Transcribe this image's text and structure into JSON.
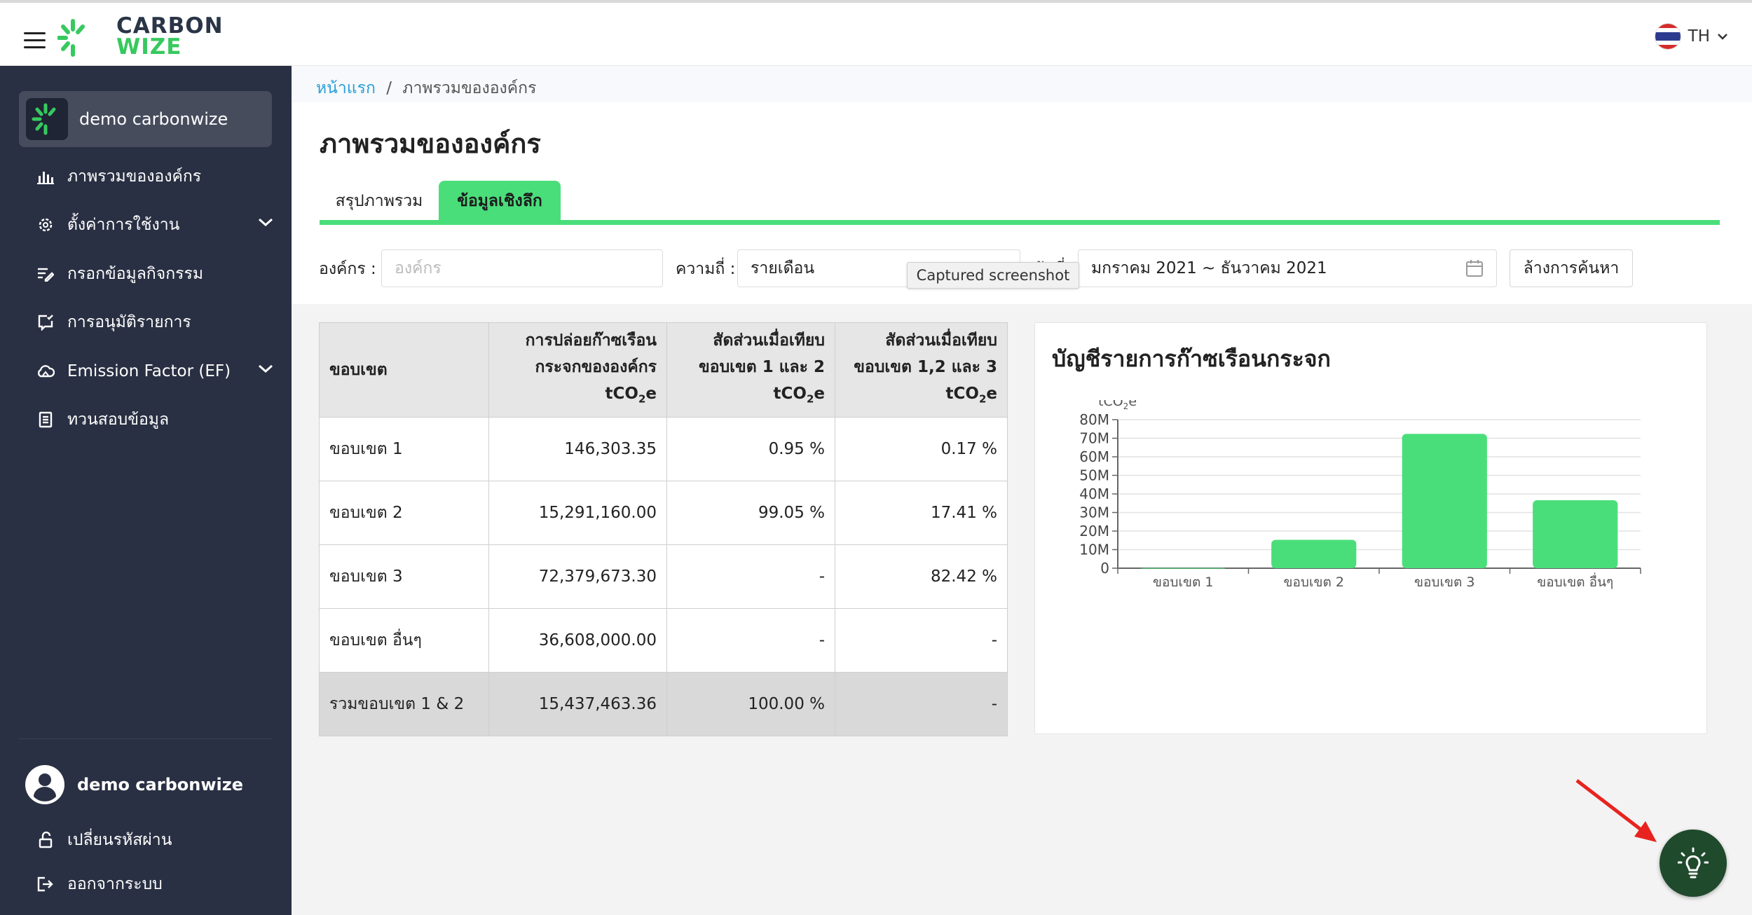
{
  "app": {
    "logo_line1": "CARBON",
    "logo_line2": "WIZE",
    "language": "TH"
  },
  "sidebar": {
    "org_name": "demo carbonwize",
    "items": [
      {
        "label": "ภาพรวมขององค์กร",
        "icon": "bar-chart-icon"
      },
      {
        "label": "ตั้งค่าการใช้งาน",
        "icon": "gear-icon"
      },
      {
        "label": "กรอกข้อมูลกิจกรรม",
        "icon": "edit-list-icon"
      },
      {
        "label": "การอนุมัติรายการ",
        "icon": "approve-icon"
      },
      {
        "label": "Emission Factor (EF)",
        "icon": "cloud-icon"
      },
      {
        "label": "ทวนสอบข้อมูล",
        "icon": "document-icon"
      }
    ],
    "user_name": "demo carbonwize",
    "change_password": "เปลี่ยนรหัสผ่าน",
    "logout": "ออกจากระบบ"
  },
  "breadcrumb": {
    "home": "หน้าแรก",
    "separator": "/",
    "current": "ภาพรวมขององค์กร"
  },
  "page": {
    "title": "ภาพรวมขององค์กร",
    "tabs": [
      "สรุปภาพรวม",
      "ข้อมูลเชิงลึก"
    ],
    "active_tab": "ข้อมูลเชิงลึก"
  },
  "filters": {
    "org_label": "องค์กร :",
    "org_placeholder": "องค์กร",
    "freq_label": "ความถี่ :",
    "freq_value": "รายเดือน",
    "date_label": "วันที่",
    "date_value": "มกราคม 2021 ~ ธันวาคม 2021",
    "clear_button": "ล้างการค้นหา",
    "tooltip": "Captured screenshot"
  },
  "table": {
    "headers": {
      "scope": "ขอบเขต",
      "emission_l1": "การปล่อยก๊าซเรือน",
      "emission_l2": "กระจกขององค์กร",
      "ratio12_l1": "สัดส่วนเมื่อเทียบ",
      "ratio12_l2": "ขอบเขต 1 และ 2",
      "ratio123_l1": "สัดส่วนเมื่อเทียบ",
      "ratio123_l2": "ขอบเขต 1,2 และ 3",
      "unit_pre": "tCO",
      "unit_sub": "2",
      "unit_post": "e"
    },
    "rows": [
      {
        "scope": "ขอบเขต 1",
        "emission": "146,303.35",
        "ratio12": "0.95 %",
        "ratio123": "0.17 %"
      },
      {
        "scope": "ขอบเขต 2",
        "emission": "15,291,160.00",
        "ratio12": "99.05 %",
        "ratio123": "17.41 %"
      },
      {
        "scope": "ขอบเขต 3",
        "emission": "72,379,673.30",
        "ratio12": "-",
        "ratio123": "82.42 %"
      },
      {
        "scope": "ขอบเขต อื่นๆ",
        "emission": "36,608,000.00",
        "ratio12": "-",
        "ratio123": "-"
      },
      {
        "scope": "รวมขอบเขต 1 & 2",
        "emission": "15,437,463.36",
        "ratio12": "100.00 %",
        "ratio123": "-"
      }
    ]
  },
  "chart_data": {
    "type": "bar",
    "title": "บัญชีรายการก๊าซเรือนกระจก",
    "ylabel": "tCO2e",
    "categories": [
      "ขอบเขต 1",
      "ขอบเขต 2",
      "ขอบเขต 3",
      "ขอบเขต อื่นๆ"
    ],
    "values": [
      146303.35,
      15291160.0,
      72379673.3,
      36608000.0
    ],
    "ylim": [
      0,
      80000000
    ],
    "yticks": [
      0,
      10000000,
      20000000,
      30000000,
      40000000,
      50000000,
      60000000,
      70000000,
      80000000
    ],
    "ytick_labels": [
      "0",
      "10M",
      "20M",
      "30M",
      "40M",
      "50M",
      "60M",
      "70M",
      "80M"
    ],
    "bar_color": "#4ade7b",
    "grid": true
  },
  "colors": {
    "accent": "#4ade7b",
    "sidebar_bg": "#2a3043",
    "fab_bg": "#1f4a2c",
    "annotation_arrow": "#e8231f"
  }
}
